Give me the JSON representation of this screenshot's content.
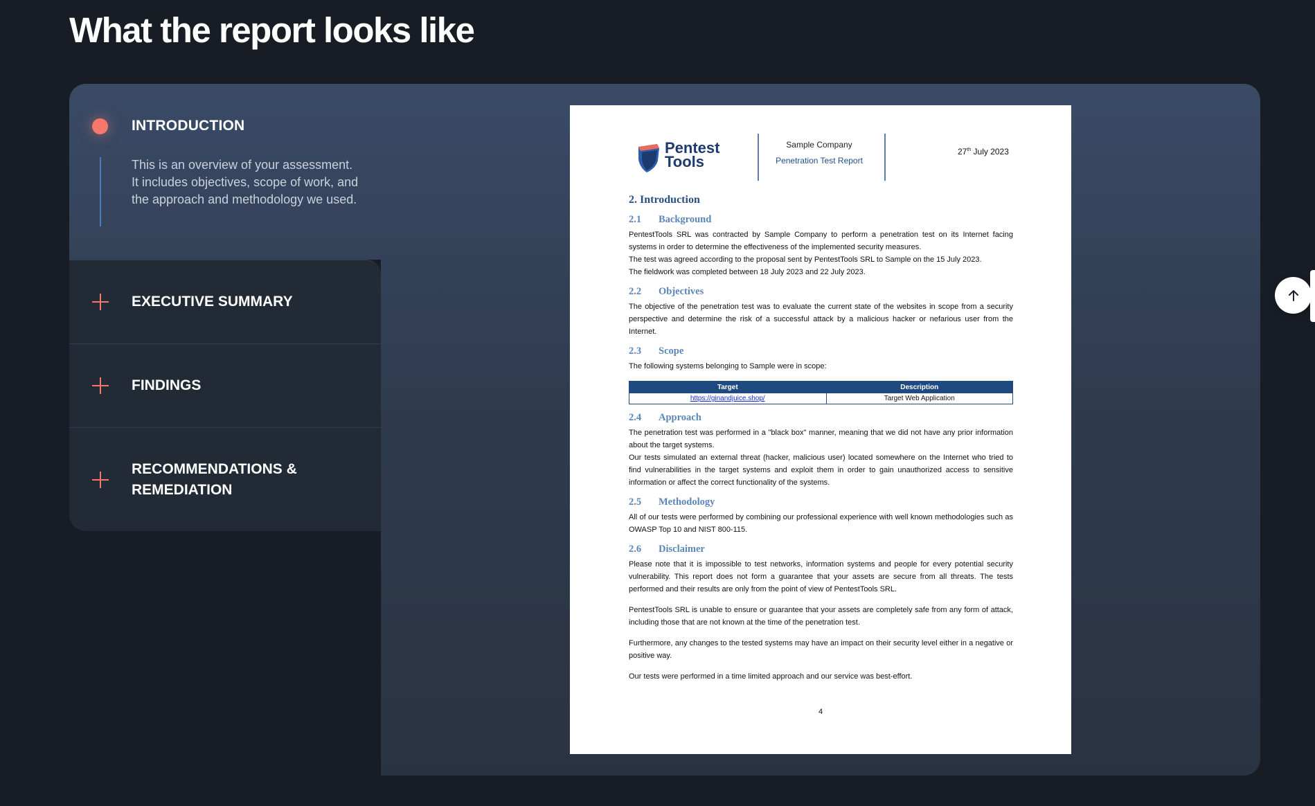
{
  "section": {
    "title": "What the report looks like"
  },
  "accordion": {
    "open": {
      "title": "INTRODUCTION",
      "description": "This is an overview of your assessment. It includes objectives, scope of work, and the approach and methodology we used."
    },
    "items": [
      {
        "label": "EXECUTIVE SUMMARY"
      },
      {
        "label": "FINDINGS"
      },
      {
        "label": "RECOMMENDATIONS & REMEDIATION"
      }
    ]
  },
  "report": {
    "logo_line1": "Pentest",
    "logo_line2": "Tools",
    "company": "Sample Company",
    "report_title": "Penetration Test Report",
    "date_day": "27",
    "date_suffix": "th",
    "date_rest": " July 2023",
    "heading": "2.  Introduction",
    "sections": [
      {
        "num": "2.1",
        "title": "Background",
        "paras": [
          "PentestTools SRL was contracted by Sample Company to perform a penetration test on its Internet facing systems in order to determine the effectiveness of the implemented security measures.",
          "The test was agreed according to the proposal sent by PentestTools SRL to Sample on the 15 July 2023.",
          "The fieldwork was completed between 18 July 2023 and 22 July 2023."
        ]
      },
      {
        "num": "2.2",
        "title": "Objectives",
        "paras": [
          "The objective of the penetration test was to evaluate the current state of the websites in scope from a security perspective and determine the risk of a successful attack by a malicious hacker or nefarious user from the Internet."
        ]
      },
      {
        "num": "2.3",
        "title": "Scope",
        "paras": [
          "The following systems belonging to Sample were in scope:"
        ]
      },
      {
        "num": "2.4",
        "title": "Approach",
        "paras": [
          "The penetration test was performed in a \"black box\" manner, meaning that we did not have any prior information about the target systems.",
          "Our tests simulated an external threat (hacker, malicious user) located somewhere on the Internet who tried to find vulnerabilities in the target systems and exploit them in order to gain unauthorized access to sensitive information or affect the correct functionality of the systems."
        ]
      },
      {
        "num": "2.5",
        "title": "Methodology",
        "paras": [
          "All of our tests were performed by combining our professional experience with well known methodologies such as OWASP Top 10 and NIST 800-115."
        ]
      },
      {
        "num": "2.6",
        "title": "Disclaimer",
        "paras": [
          "Please note that it is impossible to test networks, information systems and people for every potential security vulnerability. This report does not form a guarantee that your assets are secure from all threats. The tests performed and their results are only from the point of view of PentestTools SRL."
        ],
        "extra": [
          "PentestTools SRL is unable to ensure or guarantee that your assets are completely safe from any form of attack, including those that are not known at the time of the penetration test.",
          "Furthermore, any changes to the tested systems may have an impact on their security level either in a negative or positive way.",
          "Our tests were performed in a time limited approach and our service was best-effort."
        ]
      }
    ],
    "scope_table": {
      "headers": [
        "Target",
        "Description"
      ],
      "row": [
        "https://ginandjuice.shop/",
        "Target Web Application"
      ]
    },
    "page_number": "4"
  },
  "icons": {
    "scroll_top": "arrow-up-icon",
    "accent": "#f7786b"
  }
}
